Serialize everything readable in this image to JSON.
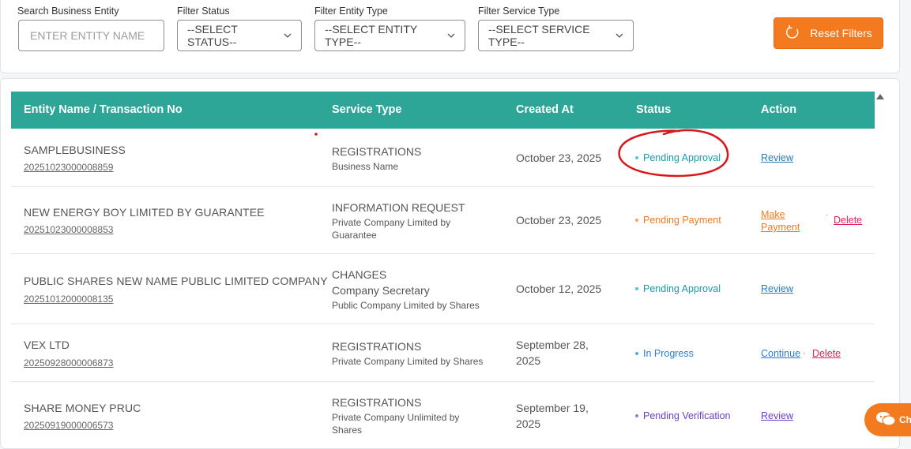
{
  "filters": {
    "search_label": "Search Business Entity",
    "search_placeholder": "ENTER ENTITY NAME",
    "status_label": "Filter Status",
    "status_value": "--SELECT STATUS--",
    "entity_type_label": "Filter Entity Type",
    "entity_type_value": "--SELECT ENTITY TYPE--",
    "service_type_label": "Filter Service Type",
    "service_type_value": "--SELECT SERVICE TYPE--",
    "reset_label": "Reset Filters"
  },
  "table": {
    "headers": [
      "Entity Name / Transaction No",
      "Service Type",
      "Created At",
      "Status",
      "Action"
    ],
    "rows": [
      {
        "name": "SAMPLEBUSINESS",
        "txn": "20251023000008859",
        "service": "REGISTRATIONS",
        "service_mid": "",
        "service_sub": "Business Name",
        "date": "October 23, 2025",
        "status": "Pending Approval",
        "status_color": "#1a9aa8",
        "action1": "Review",
        "action1_color": "#2a7ab8",
        "action2": ""
      },
      {
        "name": "NEW ENERGY BOY LIMITED BY GUARANTEE",
        "txn": "20251023000008853",
        "service": "INFORMATION REQUEST",
        "service_mid": "",
        "service_sub": "Private Company Limited by Guarantee",
        "date": "October 23, 2025",
        "status": "Pending Payment",
        "status_color": "#ef7a22",
        "action1": "Make Payment",
        "action1_color": "#ef7a22",
        "action2": "Delete"
      },
      {
        "name": "PUBLIC SHARES NEW NAME PUBLIC LIMITED COMPANY",
        "txn": "20251012000008135",
        "service": "CHANGES",
        "service_mid": "Company Secretary",
        "service_sub": "Public Company Limited by Shares",
        "date": "October 12, 2025",
        "status": "Pending Approval",
        "status_color": "#1a9aa8",
        "action1": "Review",
        "action1_color": "#2a7ab8",
        "action2": ""
      },
      {
        "name": "VEX LTD",
        "txn": "20250928000006873",
        "service": "REGISTRATIONS",
        "service_mid": "",
        "service_sub": "Private Company Limited by Shares",
        "date": "September 28, 2025",
        "status": "In Progress",
        "status_color": "#2a7fd4",
        "action1": "Continue",
        "action1_color": "#2a7fd4",
        "action2": "Delete"
      },
      {
        "name": "SHARE MONEY PRUC",
        "txn": "20250919000006573",
        "service": "REGISTRATIONS",
        "service_mid": "",
        "service_sub": "Private Company Unlimited by Shares",
        "date": "September 19, 2025",
        "status": "Pending Verification",
        "status_color": "#6a3fc8",
        "action1": "Review",
        "action1_color": "#6a3fc8",
        "action2": ""
      }
    ]
  },
  "chat": {
    "label": "Ch"
  },
  "colors": {
    "header": "#2da597",
    "accent": "#f47a20",
    "delete": "#e0245e"
  }
}
